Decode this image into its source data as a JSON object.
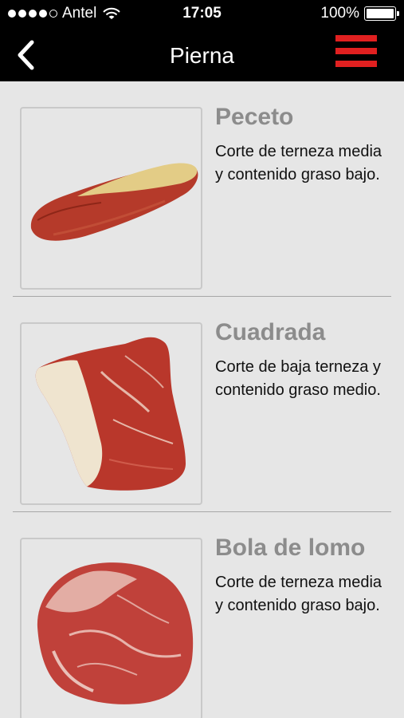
{
  "status_bar": {
    "carrier": "Antel",
    "time": "17:05",
    "battery": "100%",
    "signal_bars": 4
  },
  "navbar": {
    "title": "Pierna",
    "back_icon": "chevron-left-icon",
    "menu_icon": "hamburger-menu-icon",
    "menu_color": "#e02020"
  },
  "items": [
    {
      "title": "Peceto",
      "description": "Corte de terneza media y contenido graso bajo."
    },
    {
      "title": "Cuadrada",
      "description": "Corte de baja terneza y contenido graso medio."
    },
    {
      "title": "Bola de lomo",
      "description": "Corte de terneza media y contenido graso bajo."
    }
  ]
}
